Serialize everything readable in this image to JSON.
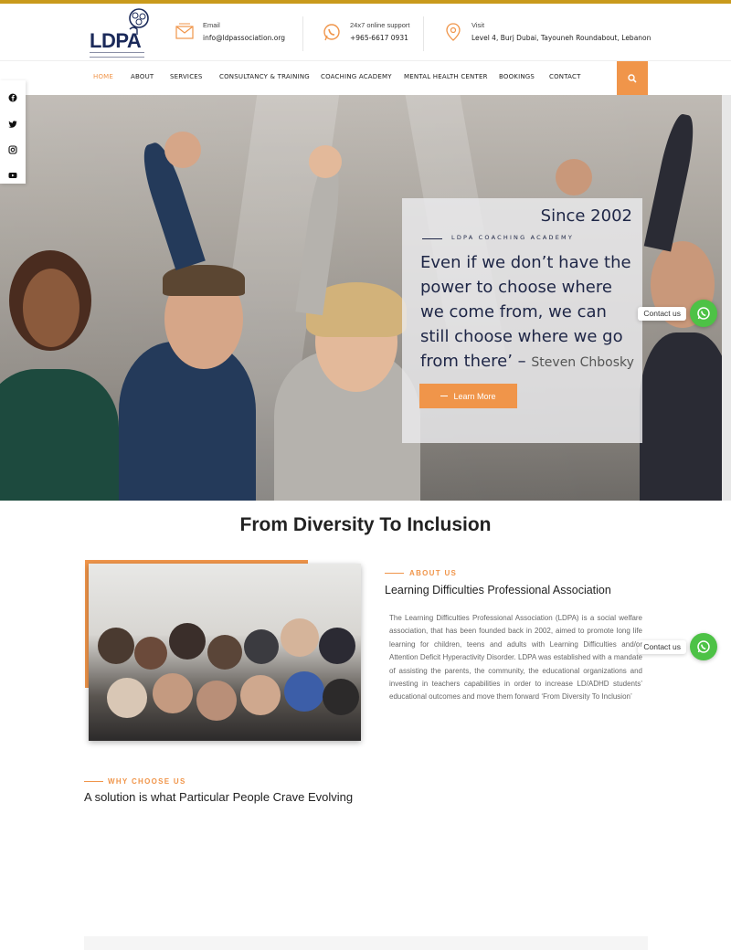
{
  "header": {
    "logo_text": "LDPA",
    "email": {
      "label": "Email",
      "value": "info@ldpassociation.org",
      "icon": "envelope-icon"
    },
    "support": {
      "label": "24x7 online support",
      "value": "+965-6617 0931",
      "icon": "whatsapp-icon"
    },
    "visit": {
      "label": "Visit",
      "value": "Level 4, Burj Dubai, Tayouneh Roundabout, Lebanon",
      "icon": "map-pin-icon"
    }
  },
  "nav": {
    "items": [
      "HOME",
      "ABOUT",
      "SERVICES",
      "CONSULTANCY & TRAINING",
      "COACHING ACADEMY",
      "MENTAL HEALTH CENTER",
      "BOOKINGS",
      "CONTACT"
    ],
    "active": "HOME",
    "search_icon": "search-icon"
  },
  "social": [
    "facebook-icon",
    "twitter-icon",
    "instagram-icon",
    "youtube-icon"
  ],
  "hero": {
    "since": "Since 2002",
    "kicker": "LDPA COACHING ACADEMY",
    "quote": "Even if we don’t have the power to choose where we come from, we can still choose where we go from there’ –",
    "author": "Steven Chbosky",
    "button": "Learn More"
  },
  "contact_widget": {
    "label": "Contact us"
  },
  "section": {
    "title": "From Diversity To Inclusion",
    "about_kicker": "ABOUT US",
    "about_heading": "Learning Difficulties Professional Association",
    "about_body": "The Learning Difficulties Professional Association (LDPA) is a social welfare association, that has been founded back in 2002, aimed to promote long life learning for children, teens and adults with Learning Difficulties and/or Attention Deficit Hyperactivity Disorder. LDPA was established with a mandate of assisting the parents, the community, the educational organizations and investing in teachers capabilities in order to increase LD/ADHD students’ educational outcomes and move them forward ‘From Diversity To Inclusion’",
    "why_kicker": "WHY CHOOSE US",
    "why_heading": "A solution is what Particular People Crave Evolving"
  },
  "colors": {
    "accent": "#f0954a",
    "navy": "#1e2646",
    "top_bar": "#c99a1c",
    "whatsapp": "#4dc246"
  }
}
